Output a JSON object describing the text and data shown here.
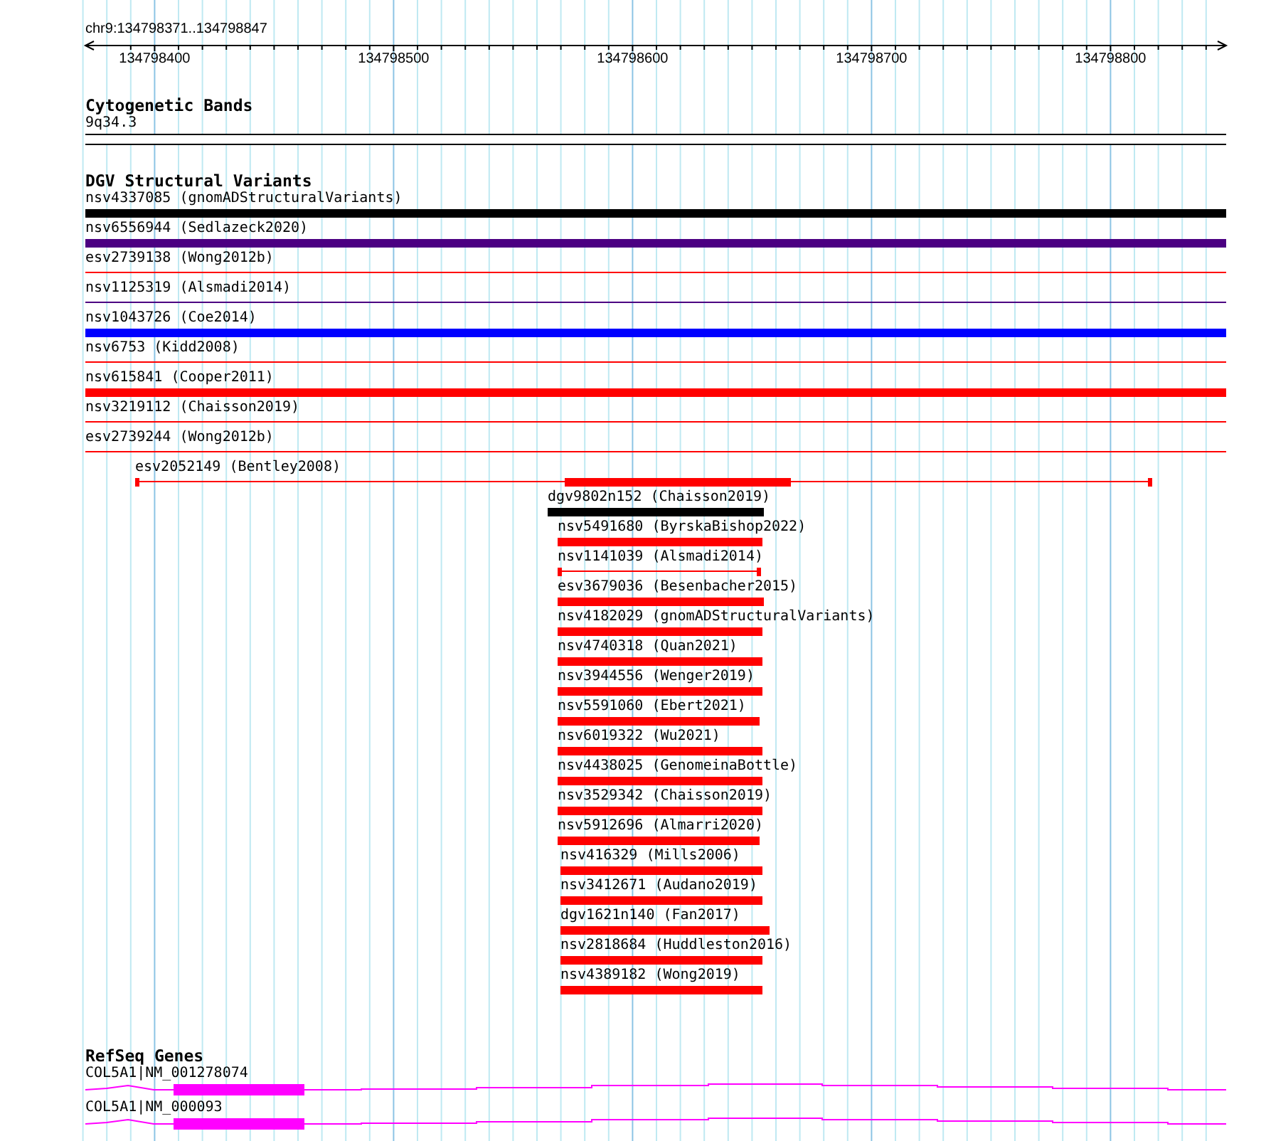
{
  "location": "chr9:134798371..134798847",
  "ruler": {
    "ticks": [
      "134798400",
      "134798500",
      "134798600",
      "134798700",
      "134798800"
    ]
  },
  "tracks": [
    {
      "title": "Cytogenetic Bands",
      "kind": "cytoband",
      "features": [
        {
          "label": "9q34.3"
        }
      ]
    },
    {
      "title": "DGV Structural Variants",
      "kind": "variants",
      "features": [
        {
          "label": "nsv4337085 (gnomADStructuralVariants)",
          "color": "#000000",
          "kind": "thick"
        },
        {
          "label": "nsv6556944 (Sedlazeck2020)",
          "color": "#4b0082",
          "kind": "thick"
        },
        {
          "label": "esv2739138 (Wong2012b)",
          "color": "#ff0000",
          "kind": "thin"
        },
        {
          "label": "nsv1125319 (Alsmadi2014)",
          "color": "#4b0082",
          "kind": "thin"
        },
        {
          "label": "nsv1043726 (Coe2014)",
          "color": "#0000ff",
          "kind": "thick"
        },
        {
          "label": "nsv6753 (Kidd2008)",
          "color": "#ff0000",
          "kind": "thin"
        },
        {
          "label": "nsv615841 (Cooper2011)",
          "color": "#ff0000",
          "kind": "thick"
        },
        {
          "label": "nsv3219112 (Chaisson2019)",
          "color": "#ff0000",
          "kind": "thin"
        },
        {
          "label": "esv2739244 (Wong2012b)",
          "color": "#ff0000",
          "kind": "thin"
        },
        {
          "label": "esv2052149 (Bentley2008)",
          "color": "#ff0000",
          "kind": "mixed"
        },
        {
          "label": "dgv9802n152 (Chaisson2019)",
          "color": "#000000",
          "kind": "thick"
        },
        {
          "label": "nsv5491680 (ByrskaBishop2022)",
          "color": "#ff0000",
          "kind": "thick"
        },
        {
          "label": "nsv1141039 (Alsmadi2014)",
          "color": "#ff0000",
          "kind": "capped"
        },
        {
          "label": "esv3679036 (Besenbacher2015)",
          "color": "#ff0000",
          "kind": "thick"
        },
        {
          "label": "nsv4182029 (gnomADStructuralVariants)",
          "color": "#ff0000",
          "kind": "thick"
        },
        {
          "label": "nsv4740318 (Quan2021)",
          "color": "#ff0000",
          "kind": "thick"
        },
        {
          "label": "nsv3944556 (Wenger2019)",
          "color": "#ff0000",
          "kind": "thick"
        },
        {
          "label": "nsv5591060 (Ebert2021)",
          "color": "#ff0000",
          "kind": "thick"
        },
        {
          "label": "nsv6019322 (Wu2021)",
          "color": "#ff0000",
          "kind": "thick"
        },
        {
          "label": "nsv4438025 (GenomeinaBottle)",
          "color": "#ff0000",
          "kind": "thick"
        },
        {
          "label": "nsv3529342 (Chaisson2019)",
          "color": "#ff0000",
          "kind": "thick"
        },
        {
          "label": "nsv5912696 (Almarri2020)",
          "color": "#ff0000",
          "kind": "thick"
        },
        {
          "label": "nsv416329 (Mills2006)",
          "color": "#ff0000",
          "kind": "thick"
        },
        {
          "label": "nsv3412671 (Audano2019)",
          "color": "#ff0000",
          "kind": "thick"
        },
        {
          "label": "dgv1621n140 (Fan2017)",
          "color": "#ff0000",
          "kind": "thick"
        },
        {
          "label": "nsv2818684 (Huddleston2016)",
          "color": "#ff0000",
          "kind": "thick"
        },
        {
          "label": "nsv4389182 (Wong2019)",
          "color": "#ff0000",
          "kind": "thick"
        }
      ]
    },
    {
      "title": "RefSeq Genes",
      "kind": "genes",
      "features": [
        {
          "label": "COL5A1|NM_001278074"
        },
        {
          "label": "COL5A1|NM_000093"
        }
      ]
    }
  ]
}
